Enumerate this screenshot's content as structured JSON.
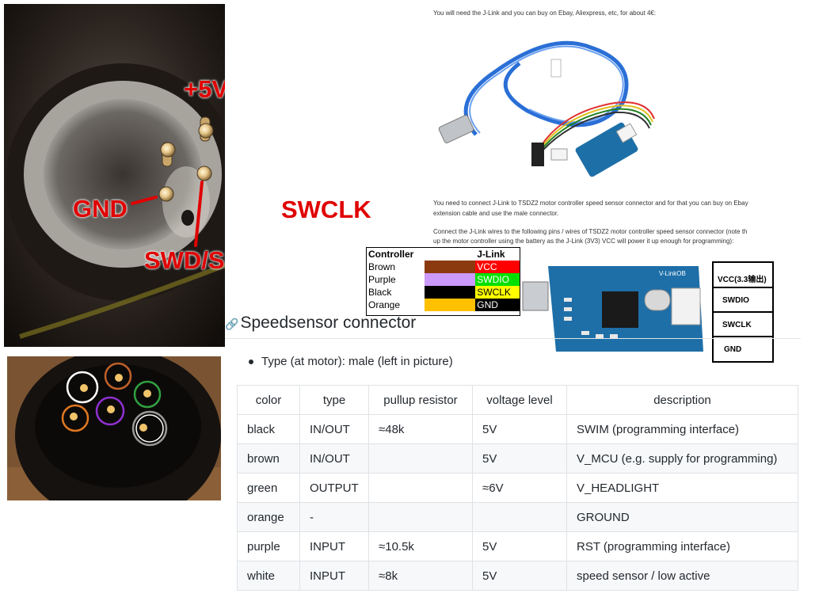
{
  "photo_labels": {
    "plus5v": "+5V",
    "gnd": "GND",
    "swd": "SWD/SPD",
    "swclk": "SWCLK"
  },
  "doc": {
    "line1": "You will need the J-Link and you can buy on Ebay, Aliexpress, etc, for about 4€:",
    "line2a": "You need to connect J-Link to TSDZ2 motor controller speed sensor connector and for that you can buy on Ebay",
    "line2b": "extension cable and use the male connector.",
    "line3a": "Connect the J-Link wires to the following pins / wires of TSDZ2 motor controller speed sensor connector (note th",
    "line3b": "up the motor controller using the battery as the J-Link (3V3) VCC will power it up enough for programming):"
  },
  "wire_table": {
    "header_left": "Controller",
    "header_right": "J-Link",
    "rows": [
      {
        "name": "Brown",
        "color": "#8b3a0f",
        "signal": "VCC",
        "signal_bg": "#ff0000",
        "signal_fg": "#ffffff"
      },
      {
        "name": "Purple",
        "color": "#cc99ff",
        "signal": "SWDIO",
        "signal_bg": "#00e000",
        "signal_fg": "#ffffff"
      },
      {
        "name": "Black",
        "color": "#000000",
        "signal": "SWCLK",
        "signal_bg": "#ffff00",
        "signal_fg": "#000000"
      },
      {
        "name": "Orange",
        "color": "#ffc000",
        "signal": "GND",
        "signal_bg": "#000000",
        "signal_fg": "#ffffff"
      }
    ]
  },
  "board": {
    "labels": [
      "VCC(3.3输出)",
      "SWDIO",
      "SWCLK",
      "GND"
    ],
    "silk": "V-LinkOB"
  },
  "section": {
    "heading": "Speedsensor connector",
    "bullet": "Type (at motor): male (left in picture)"
  },
  "spec_table": {
    "headers": [
      "color",
      "type",
      "pullup resistor",
      "voltage level",
      "description"
    ],
    "rows": [
      [
        "black",
        "IN/OUT",
        "≈48k",
        "5V",
        "SWIM (programming interface)"
      ],
      [
        "brown",
        "IN/OUT",
        "",
        "5V",
        "V_MCU (e.g. supply for programming)"
      ],
      [
        "green",
        "OUTPUT",
        "",
        "≈6V",
        "V_HEADLIGHT"
      ],
      [
        "orange",
        "-",
        "",
        "",
        "GROUND"
      ],
      [
        "purple",
        "INPUT",
        "≈10.5k",
        "5V",
        "RST (programming interface)"
      ],
      [
        "white",
        "INPUT",
        "≈8k",
        "5V",
        "speed sensor / low active"
      ]
    ]
  },
  "colors": {
    "label_red": "#e00000",
    "link_gray": "#586069"
  }
}
